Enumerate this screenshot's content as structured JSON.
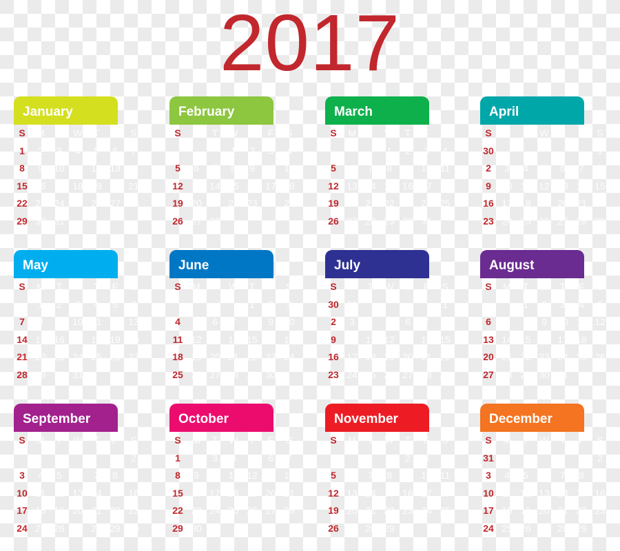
{
  "title": "2017",
  "weekday_labels": [
    "S",
    "M",
    "T",
    "W",
    "T",
    "F",
    "S"
  ],
  "months": [
    {
      "name": "January",
      "color": "#d4df1f",
      "weeks": [
        [
          "1",
          "2",
          "3",
          "4",
          "5",
          "6",
          "7"
        ],
        [
          "8",
          "9",
          "10",
          "11",
          "12",
          "13",
          "14"
        ],
        [
          "15",
          "16",
          "17",
          "18",
          "19",
          "20",
          "21"
        ],
        [
          "22",
          "23",
          "24",
          "25",
          "26",
          "27",
          "28"
        ],
        [
          "29",
          "30",
          "31",
          "",
          "",
          "",
          ""
        ]
      ]
    },
    {
      "name": "February",
      "color": "#8dc63f",
      "weeks": [
        [
          "",
          "",
          "",
          "1",
          "2",
          "3",
          "4"
        ],
        [
          "5",
          "6",
          "7",
          "8",
          "9",
          "10",
          "11"
        ],
        [
          "12",
          "13",
          "14",
          "15",
          "16",
          "17",
          "18"
        ],
        [
          "19",
          "20",
          "21",
          "22",
          "23",
          "24",
          "25"
        ],
        [
          "26",
          "27",
          "28",
          "",
          "",
          "",
          ""
        ]
      ]
    },
    {
      "name": "March",
      "color": "#0db04b",
      "weeks": [
        [
          "",
          "",
          "",
          "1",
          "2",
          "3",
          "4"
        ],
        [
          "5",
          "6",
          "7",
          "8",
          "9",
          "10",
          "11"
        ],
        [
          "12",
          "13",
          "14",
          "15",
          "16",
          "17",
          "18"
        ],
        [
          "19",
          "20",
          "21",
          "22",
          "23",
          "24",
          "25"
        ],
        [
          "26",
          "27",
          "28",
          "29",
          "30",
          "31",
          ""
        ]
      ]
    },
    {
      "name": "April",
      "color": "#00a7a9",
      "weeks": [
        [
          "30",
          "",
          "",
          "",
          "",
          "",
          "1"
        ],
        [
          "2",
          "3",
          "4",
          "5",
          "6",
          "7",
          "8"
        ],
        [
          "9",
          "10",
          "11",
          "12",
          "13",
          "14",
          "15"
        ],
        [
          "16",
          "17",
          "18",
          "19",
          "20",
          "21",
          "22"
        ],
        [
          "23",
          "24",
          "25",
          "26",
          "27",
          "28",
          "29"
        ]
      ]
    },
    {
      "name": "May",
      "color": "#00aeef",
      "weeks": [
        [
          "",
          "1",
          "2",
          "3",
          "4",
          "5",
          "6"
        ],
        [
          "7",
          "8",
          "9",
          "10",
          "11",
          "12",
          "13"
        ],
        [
          "14",
          "15",
          "16",
          "17",
          "18",
          "19",
          "20"
        ],
        [
          "21",
          "22",
          "23",
          "24",
          "25",
          "26",
          "27"
        ],
        [
          "28",
          "29",
          "30",
          "31",
          "",
          "",
          ""
        ]
      ]
    },
    {
      "name": "June",
      "color": "#0077c4",
      "weeks": [
        [
          "",
          "",
          "",
          "",
          "1",
          "2",
          "3"
        ],
        [
          "4",
          "5",
          "6",
          "7",
          "8",
          "9",
          "10"
        ],
        [
          "11",
          "12",
          "13",
          "14",
          "15",
          "16",
          "17"
        ],
        [
          "18",
          "19",
          "20",
          "21",
          "22",
          "23",
          "24"
        ],
        [
          "25",
          "26",
          "27",
          "28",
          "29",
          "30",
          ""
        ]
      ]
    },
    {
      "name": "July",
      "color": "#2e3192",
      "weeks": [
        [
          "30",
          "31",
          "",
          "",
          "",
          "",
          "1"
        ],
        [
          "2",
          "3",
          "4",
          "5",
          "6",
          "7",
          "8"
        ],
        [
          "9",
          "10",
          "11",
          "12",
          "13",
          "14",
          "15"
        ],
        [
          "16",
          "17",
          "18",
          "19",
          "20",
          "21",
          "22"
        ],
        [
          "23",
          "24",
          "25",
          "26",
          "27",
          "28",
          "29"
        ]
      ]
    },
    {
      "name": "August",
      "color": "#6a2c91",
      "weeks": [
        [
          "",
          "",
          "1",
          "2",
          "3",
          "4",
          "5"
        ],
        [
          "6",
          "7",
          "8",
          "9",
          "10",
          "11",
          "12"
        ],
        [
          "13",
          "14",
          "15",
          "16",
          "17",
          "18",
          "19"
        ],
        [
          "20",
          "21",
          "22",
          "23",
          "24",
          "25",
          "26"
        ],
        [
          "27",
          "28",
          "29",
          "30",
          "31",
          "",
          ""
        ]
      ]
    },
    {
      "name": "September",
      "color": "#a2218d",
      "weeks": [
        [
          "",
          "",
          "",
          "",
          "",
          "1",
          "2"
        ],
        [
          "3",
          "4",
          "5",
          "6",
          "7",
          "8",
          "9"
        ],
        [
          "10",
          "11",
          "12",
          "13",
          "14",
          "15",
          "16"
        ],
        [
          "17",
          "18",
          "19",
          "20",
          "21",
          "22",
          "23"
        ],
        [
          "24",
          "25",
          "26",
          "27",
          "28",
          "29",
          "30"
        ]
      ]
    },
    {
      "name": "October",
      "color": "#ec0c6e",
      "weeks": [
        [
          "1",
          "2",
          "3",
          "4",
          "5",
          "6",
          "7"
        ],
        [
          "8",
          "9",
          "10",
          "11",
          "12",
          "13",
          "14"
        ],
        [
          "15",
          "16",
          "17",
          "18",
          "19",
          "20",
          "21"
        ],
        [
          "22",
          "23",
          "24",
          "25",
          "26",
          "27",
          "28"
        ],
        [
          "29",
          "30",
          "31",
          "",
          "",
          "",
          ""
        ]
      ]
    },
    {
      "name": "November",
      "color": "#ed1c24",
      "weeks": [
        [
          "",
          "",
          "",
          "1",
          "2",
          "3",
          "4"
        ],
        [
          "5",
          "6",
          "7",
          "8",
          "9",
          "10",
          "11"
        ],
        [
          "12",
          "13",
          "14",
          "15",
          "16",
          "17",
          "18"
        ],
        [
          "19",
          "20",
          "21",
          "22",
          "23",
          "24",
          "25"
        ],
        [
          "26",
          "27",
          "28",
          "29",
          "30",
          "",
          ""
        ]
      ]
    },
    {
      "name": "December",
      "color": "#f47421",
      "weeks": [
        [
          "31",
          "",
          "",
          "",
          "",
          "1",
          "2"
        ],
        [
          "3",
          "4",
          "5",
          "6",
          "7",
          "8",
          "9"
        ],
        [
          "10",
          "11",
          "12",
          "13",
          "14",
          "15",
          "16"
        ],
        [
          "17",
          "18",
          "19",
          "20",
          "21",
          "22",
          "23"
        ],
        [
          "24",
          "25",
          "26",
          "27",
          "28",
          "29",
          "30"
        ]
      ]
    }
  ]
}
